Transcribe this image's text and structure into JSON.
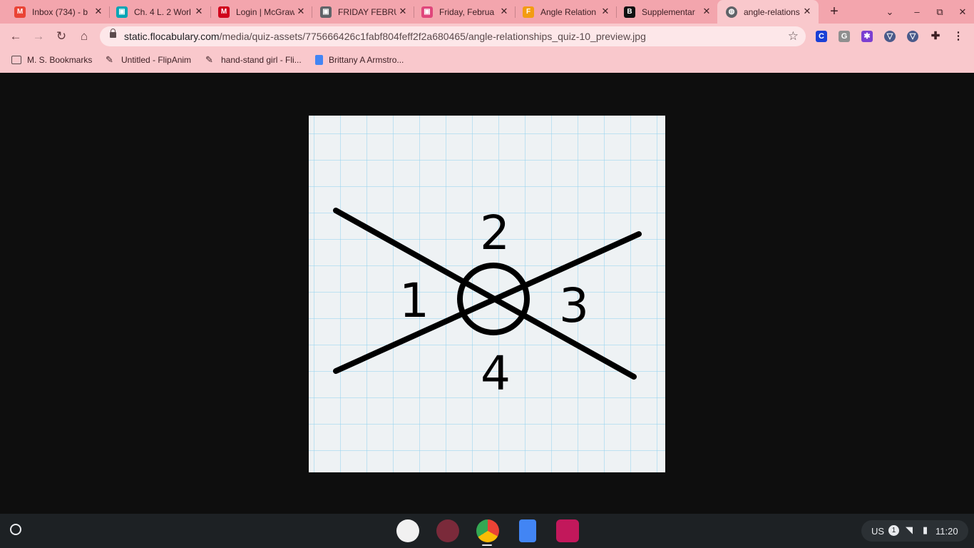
{
  "tabs": [
    {
      "title": "Inbox (734) - b",
      "fav_color": "#ea4335",
      "fav_glyph": "M"
    },
    {
      "title": "Ch. 4 L. 2 Worl",
      "fav_color": "#00a5b5",
      "fav_glyph": "▣"
    },
    {
      "title": "Login | McGraw",
      "fav_color": "#d0021b",
      "fav_glyph": "M"
    },
    {
      "title": "FRIDAY FEBRU",
      "fav_color": "#5f6368",
      "fav_glyph": "▣"
    },
    {
      "title": "Friday, Februa",
      "fav_color": "#e0457b",
      "fav_glyph": "▣"
    },
    {
      "title": "Angle Relation",
      "fav_color": "#f39c12",
      "fav_glyph": "F"
    },
    {
      "title": "Supplementar",
      "fav_color": "#111111",
      "fav_glyph": "B"
    },
    {
      "title": "angle-relations",
      "fav_color": "#5f6368",
      "fav_glyph": "◍"
    }
  ],
  "address": {
    "host": "static.flocabulary.com",
    "path": "/media/quiz-assets/775666426c1fabf804feff2f2a680465/angle-relationships_quiz-10_preview.jpg"
  },
  "bookmarks": [
    {
      "label": "M. S. Bookmarks"
    },
    {
      "label": "Untitled - FlipAnim"
    },
    {
      "label": "hand-stand girl - Fli..."
    },
    {
      "label": "Brittany A Armstro..."
    }
  ],
  "figure": {
    "labels": [
      "1",
      "2",
      "3",
      "4"
    ]
  },
  "status_tray": {
    "keyboard": "US",
    "notifications": "1",
    "time": "11:20"
  },
  "colors": {
    "tab_strip": "#f3a5ad",
    "toolbar": "#f9c8cc",
    "page_background": "#0e0e0e",
    "grid_paper": "#eef2f4",
    "grid_lines": "#8fd0ee"
  }
}
